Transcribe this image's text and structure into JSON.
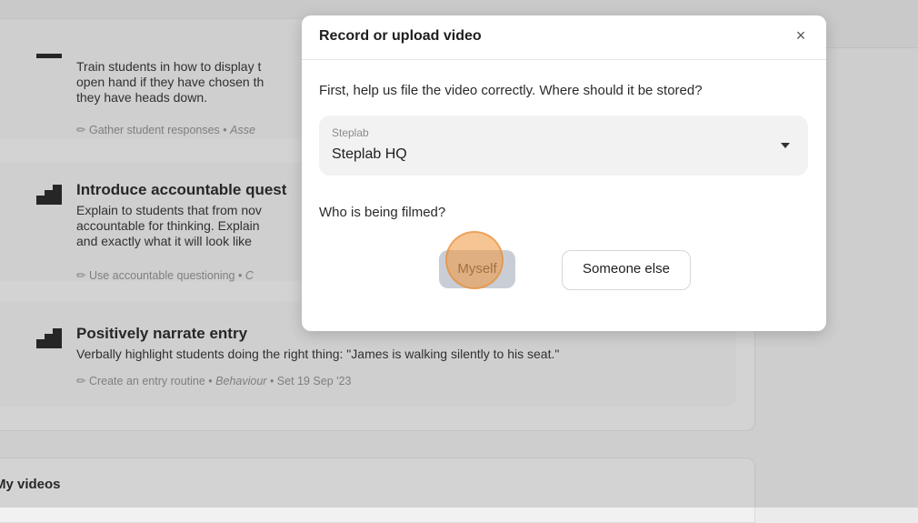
{
  "background": {
    "steps": [
      {
        "title": "",
        "desc_lines": [
          "Train students in how to display t",
          "open hand if they have chosen th",
          "they have heads down."
        ],
        "meta_prefix": "Gather student responses •",
        "meta_category": "Asse",
        "meta_suffix": ""
      },
      {
        "title": "Introduce accountable quest",
        "desc_lines": [
          "Explain to students that from nov",
          "accountable for thinking. Explain",
          "and exactly what it will look like"
        ],
        "meta_prefix": "Use accountable questioning •",
        "meta_category": "C",
        "meta_suffix": ""
      },
      {
        "title": "Positively narrate entry",
        "desc_lines": [
          "Verbally highlight students doing the right thing: \"James is walking silently to his seat.\""
        ],
        "meta_prefix": "Create an entry routine •",
        "meta_category": "Behaviour",
        "meta_suffix": "• Set 19 Sep '23"
      }
    ],
    "videos_title": "My videos"
  },
  "modal": {
    "title": "Record or upload video",
    "close_icon": "×",
    "question_storage": "First, help us file the video correctly. Where should it be stored?",
    "select": {
      "label": "Steplab",
      "value": "Steplab HQ"
    },
    "question_filmed": "Who is being filmed?",
    "buttons": {
      "myself": "Myself",
      "someone_else": "Someone else"
    }
  },
  "colors": {
    "myself_selected": "#c9ced6",
    "click_indicator": "#f0963c"
  }
}
